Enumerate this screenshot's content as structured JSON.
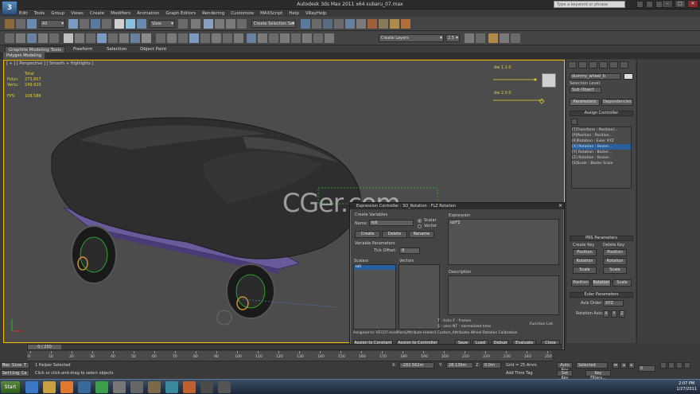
{
  "window": {
    "title": "Autodesk 3ds Max  2011 x64     subaru_07.max",
    "search_placeholder": "Type a keyword or phrase",
    "minimize": "–",
    "maximize": "□",
    "close": "✕"
  },
  "menu": [
    "Edit",
    "Tools",
    "Group",
    "Views",
    "Create",
    "Modifiers",
    "Animation",
    "Graph Editors",
    "Rendering",
    "Customize",
    "MAXScript",
    "Help",
    "VRayHelp"
  ],
  "toolbar": {
    "selection_filter": "All",
    "view_dropdown": "View",
    "named_selection": "Create Selection Set",
    "layer_dropdown": "Create Layers",
    "snaps_value": "2.5"
  },
  "ribbon": {
    "tabs": [
      "Graphite Modeling Tools",
      "Freeform",
      "Selection",
      "Object Paint"
    ],
    "active_index": 0,
    "sub_chip": "Polygon Modeling"
  },
  "viewport": {
    "label": "[ + ] [ Perspective ] [ Smooth + Highlights ]",
    "stats": [
      {
        "k": "",
        "v": "Total"
      },
      {
        "k": "Polys:",
        "v": "273,857"
      },
      {
        "k": "Verts:",
        "v": "249,920"
      },
      {
        "k": "",
        "v": ""
      },
      {
        "k": "FPS:",
        "v": "108.586"
      }
    ],
    "watermark": "CGer.com",
    "dw_top": "dw 1.1.0",
    "dw_bottom": "dw 2.0.0"
  },
  "dialog": {
    "title": "Expression Controller : SO_Rotation : FLZ Rotation",
    "create_variables": "Create Variables",
    "name_label": "Name:",
    "name_value": "ioli",
    "scalar": "Scalar",
    "vector": "Vector",
    "create": "Create",
    "delete": "Delete",
    "rename": "Rename",
    "variable_params": "Variable Parameters",
    "tick_offset": "Tick Offset:",
    "tick_value": "0",
    "scalars": "Scalars",
    "vectors": "Vectors",
    "scalar_item": "ioli",
    "expression_label": "Expression",
    "expression_value": "ioli*2",
    "description_label": "Description",
    "legend_1": "T : ticks     F : frames",
    "legend_2": "S : secs      NT : normalized time",
    "function_list": "Function List",
    "assigned": "Assigned to:  VECO7.modifiers[Attribute Holder].Custom_Attributes.Wheel Rotation Calibration",
    "buttons": [
      "Assign to Constant",
      "Assign to Controller",
      "Save",
      "Load",
      "Debug",
      "Evaluate",
      "Close"
    ]
  },
  "cmdpanel": {
    "object_name": "dummy_wheel_b",
    "selection_level": "Selection Level:",
    "sub_object": "Sub-Object",
    "parameters": "Parameters",
    "dependencies": "Dependencies",
    "assign_controller": "Assign Controller",
    "tree": [
      "[T]Transform : Position/...",
      "  [P]Position : Position...",
      "  [R]Rotation : Euler XYZ",
      "    [X] Rotation : Bezier...",
      "    [Y] Rotation : Bezier...",
      "    [Z] Rotation : Bezier...",
      "  [S]Scale : Bezier Scale"
    ],
    "tree_selected": 3,
    "prs": "PRS Parameters",
    "create_key": "Create Key",
    "delete_key": "Delete Key",
    "position": "Position",
    "rotation": "Rotation",
    "scale": "Scale",
    "euler": "Euler Parameters",
    "axis_order": "Axis Order:",
    "axis_order_value": "XYZ",
    "rotation_axis": "Rotation Axis:",
    "axes": [
      "X",
      "Y",
      "Z"
    ]
  },
  "timeline": {
    "thumb": "0 / 250",
    "ticks": [
      "0",
      "10",
      "20",
      "30",
      "40",
      "50",
      "60",
      "70",
      "80",
      "90",
      "100",
      "110",
      "120",
      "130",
      "140",
      "150",
      "160",
      "170",
      "180",
      "190",
      "200",
      "210",
      "220",
      "230",
      "240",
      "250"
    ]
  },
  "status": {
    "maxscript_1": "Max Sine T",
    "maxscript_2": "Setting Ca",
    "selected": "1 Helper Selected",
    "prompt": "Click or click-and-drag to select objects",
    "x": "-282.562m",
    "y": "28.136m",
    "z": "0.0m",
    "grid": "Grid = 25.4mm",
    "auto_key": "Auto Key",
    "set_key": "Set Key",
    "selected_dd": "Selected",
    "key_filters": "Key Filters...",
    "add_time_tag": "Add Time Tag",
    "frame": "0"
  },
  "taskbar": {
    "start": "Start",
    "time": "2:07 PM",
    "date": "1/27/2011"
  }
}
